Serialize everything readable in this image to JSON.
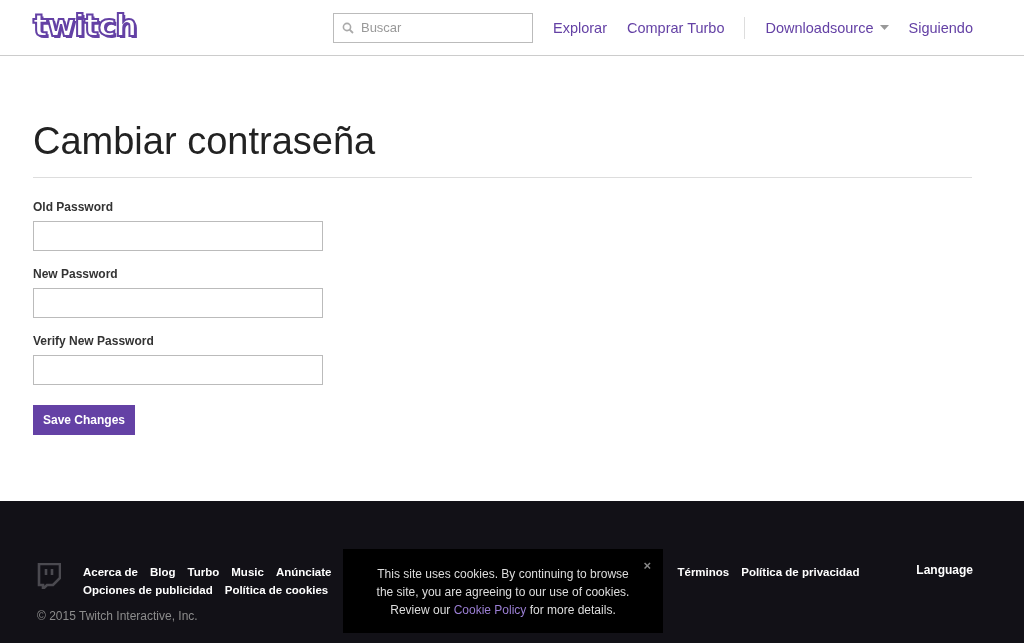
{
  "header": {
    "logo": "twitch",
    "search": {
      "placeholder": "Buscar"
    },
    "nav": [
      {
        "label": "Explorar",
        "kind": "link"
      },
      {
        "label": "Comprar Turbo",
        "kind": "link"
      },
      {
        "label": "Downloadsource",
        "kind": "user"
      },
      {
        "label": "Siguiendo",
        "kind": "link"
      }
    ]
  },
  "page": {
    "title": "Cambiar contraseña",
    "fields": [
      {
        "label": "Old Password"
      },
      {
        "label": "New Password"
      },
      {
        "label": "Verify New Password"
      }
    ],
    "button": "Save Changes"
  },
  "footer": {
    "links_row1": [
      "Acerca de",
      "Blog",
      "Turbo",
      "Music",
      "Anúnciate"
    ],
    "links_row1_after": [
      "Términos",
      "Política de privacidad"
    ],
    "links_row2": [
      "Opciones de publicidad",
      "Política de cookies"
    ],
    "language": "Language",
    "copyright": "© 2015 Twitch Interactive, Inc."
  },
  "cookie_notice": {
    "text_before": "This site uses cookies. By continuing to browse the site, you are agreeing to our use of cookies. Review our",
    "link": "Cookie Policy",
    "text_after": "for more details.",
    "close": "×"
  }
}
